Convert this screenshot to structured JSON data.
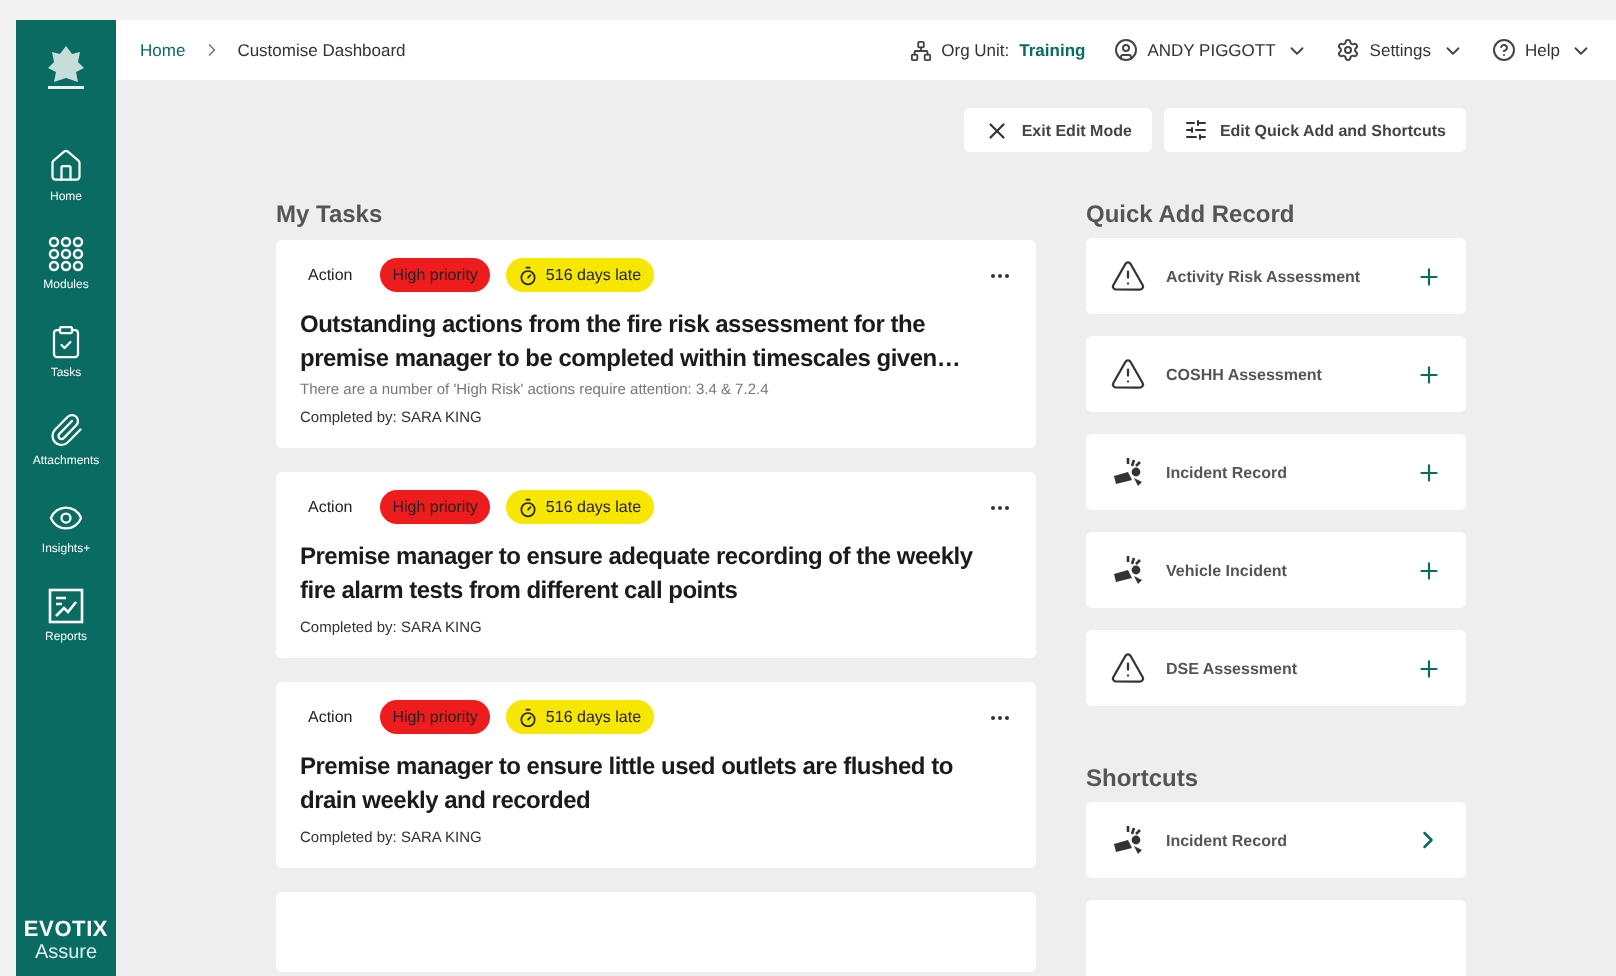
{
  "breadcrumb": [
    {
      "label": "Home",
      "link": true
    },
    {
      "label": "Customise Dashboard",
      "link": false
    }
  ],
  "header": {
    "org_unit_label": "Org Unit:",
    "org_unit": "Training",
    "user": "ANDY PIGGOTT",
    "settings": "Settings",
    "help": "Help"
  },
  "sidebar": {
    "items": [
      {
        "label": "Home",
        "kind": "home"
      },
      {
        "label": "Modules",
        "kind": "modules"
      },
      {
        "label": "Tasks",
        "kind": "tasks"
      },
      {
        "label": "Attachments",
        "kind": "attachments"
      },
      {
        "label": "Insights+",
        "kind": "insights"
      },
      {
        "label": "Reports",
        "kind": "reports"
      }
    ],
    "brand": "EVOTIX",
    "brand_sub": "Assure"
  },
  "toolbar": [
    {
      "label": "Exit Edit Mode",
      "kind": "close"
    },
    {
      "label": "Edit Quick Add and Shortcuts",
      "kind": "sliders"
    }
  ],
  "tasks": {
    "title": "My Tasks",
    "items": [
      {
        "type": "Action",
        "priority": "High priority",
        "late": "516 days late",
        "title": "Outstanding actions from the fire risk assessment for the premise manager to be completed within timescales given…",
        "description": "There are a number of 'High Risk' actions require attention: 3.4 & 7.2.4",
        "completed_by": "Completed by: SARA KING"
      },
      {
        "type": "Action",
        "priority": "High priority",
        "late": "516 days late",
        "title": "Premise manager to ensure adequate recording of the weekly fire alarm tests from different call points",
        "completed_by": "Completed by: SARA KING"
      },
      {
        "type": "Action",
        "priority": "High priority",
        "late": "516 days late",
        "title": "Premise manager to ensure little used outlets are flushed to drain weekly and recorded",
        "completed_by": "Completed by: SARA KING"
      }
    ]
  },
  "quick_add": {
    "title": "Quick Add Record",
    "items": [
      {
        "label": "Activity Risk Assessment",
        "kind": "warning"
      },
      {
        "label": "COSHH Assessment",
        "kind": "warning"
      },
      {
        "label": "Incident Record",
        "kind": "impact"
      },
      {
        "label": "Vehicle Incident",
        "kind": "impact"
      },
      {
        "label": "DSE Assessment",
        "kind": "warning"
      }
    ]
  },
  "shortcuts": {
    "title": "Shortcuts",
    "items": [
      {
        "label": "Incident Record",
        "kind": "impact"
      }
    ]
  }
}
